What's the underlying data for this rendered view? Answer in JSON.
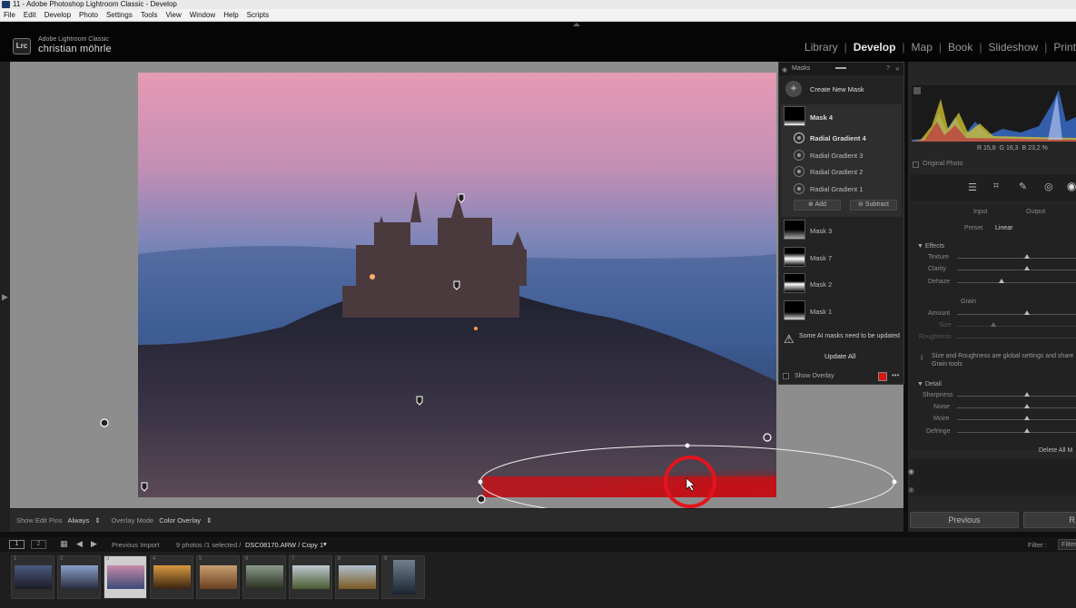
{
  "window": {
    "title": "11 - Adobe Photoshop Lightroom Classic - Develop"
  },
  "menu": [
    "File",
    "Edit",
    "Develop",
    "Photo",
    "Settings",
    "Tools",
    "View",
    "Window",
    "Help",
    "Scripts"
  ],
  "identity": {
    "badge": "Lrc",
    "product": "Adobe Lightroom Classic",
    "user": "christian möhrle"
  },
  "modules": [
    "Library",
    "Develop",
    "Map",
    "Book",
    "Slideshow",
    "Print"
  ],
  "active_module": "Develop",
  "masks_panel": {
    "title": "Masks",
    "create": "Create New Mask",
    "masks": [
      "Mask 4",
      "Mask 3",
      "Mask 7",
      "Mask 2",
      "Mask 1"
    ],
    "components": [
      "Radial Gradient 4",
      "Radial Gradient 3",
      "Radial Gradient 2",
      "Radial Gradient 1"
    ],
    "add": "Add",
    "subtract": "Subtract",
    "warning": "Some AI masks need to be updated",
    "update_all": "Update All",
    "show_overlay": "Show Overlay",
    "overlay_color": "#d81414"
  },
  "toolbar": {
    "edit_pins_label": "Show Edit Pins",
    "edit_pins_value": "Always",
    "overlay_mode_label": "Overlay Mode",
    "overlay_mode_value": "Color Overlay"
  },
  "histogram": {
    "r_label": "R",
    "r": "15,8",
    "g_label": "G",
    "g": "16,3",
    "b_label": "B",
    "b": "23,2",
    "unit": "%",
    "original_photo": "Original Photo"
  },
  "right_panel": {
    "input": "Input",
    "output": "Output",
    "preset_label": "Preset",
    "preset_value": "Linear",
    "effects": "Effects",
    "texture": "Texture",
    "clarity": "Clarity",
    "dehaze": "Dehaze",
    "grain": "Grain",
    "amount": "Amount",
    "size": "Size",
    "roughness": "Roughness",
    "grain_note": "Size and Roughness are global settings and share Grain tools",
    "detail": "Detail",
    "sharpness": "Sharpness",
    "noise": "Noise",
    "moire": "Moire",
    "defringe": "Defringe",
    "delete_all": "Delete All M",
    "previous": "Previous",
    "reset": "R"
  },
  "filmstrip_bar": {
    "view1": "1",
    "view2": "2",
    "source": "Previous Import",
    "count": "9 photos /1 selected /",
    "file": "DSC08170.ARW / Copy 1",
    "filter": "Filter :",
    "filter_value": "Filter"
  },
  "filmstrip": [
    {
      "num": "1",
      "colors": [
        "#4a5a80",
        "#1c1c24"
      ]
    },
    {
      "num": "2",
      "colors": [
        "#8aa0c8",
        "#2a2e40"
      ]
    },
    {
      "num": "3",
      "colors": [
        "#c88aa8",
        "#3a4a78"
      ]
    },
    {
      "num": "4",
      "colors": [
        "#d89a40",
        "#3a2410"
      ]
    },
    {
      "num": "5",
      "colors": [
        "#c8a070",
        "#6a4020"
      ]
    },
    {
      "num": "6",
      "colors": [
        "#8a9a8a",
        "#2a3020"
      ]
    },
    {
      "num": "7",
      "colors": [
        "#c0c8d0",
        "#4a5a30"
      ]
    },
    {
      "num": "8",
      "colors": [
        "#b0c0d0",
        "#7a5a20"
      ]
    },
    {
      "num": "9",
      "colors": [
        "#708090",
        "#1a2430"
      ]
    }
  ]
}
